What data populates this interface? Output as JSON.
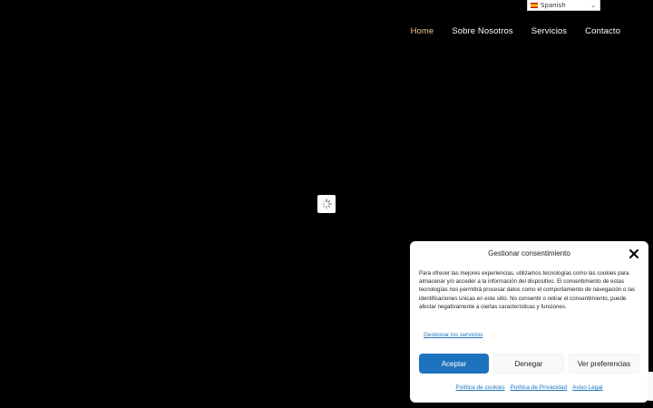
{
  "language": {
    "selected": "Spanish",
    "flag_icon": "spain-flag-icon"
  },
  "nav": {
    "items": [
      {
        "label": "Home",
        "active": true
      },
      {
        "label": "Sobre Nosotros",
        "active": false
      },
      {
        "label": "Servicios",
        "active": false
      },
      {
        "label": "Contacto",
        "active": false
      }
    ],
    "active_color": "#f3c79c"
  },
  "consent": {
    "title": "Gestionar consentimiento",
    "body": "Para ofrecer las mejores experiencias, utilizamos tecnologías como las cookies para almacenar y/o acceder a la información del dispositivo. El consentimiento de estas tecnologías nos permitirá procesar datos como el comportamiento de navegación o las identificaciones únicas en este sitio. No consentir o retirar el consentimiento, puede afectar negativamente a ciertas características y funciones.",
    "manage_link": "Gestionar los servicios",
    "buttons": {
      "accept": "Aceptar",
      "deny": "Denegar",
      "preferences": "Ver preferencias"
    },
    "links": {
      "cookies": "Política de cookies",
      "privacy": "Política de Privacidad",
      "legal": "Aviso Legal"
    },
    "accent_color": "#1e73be"
  }
}
